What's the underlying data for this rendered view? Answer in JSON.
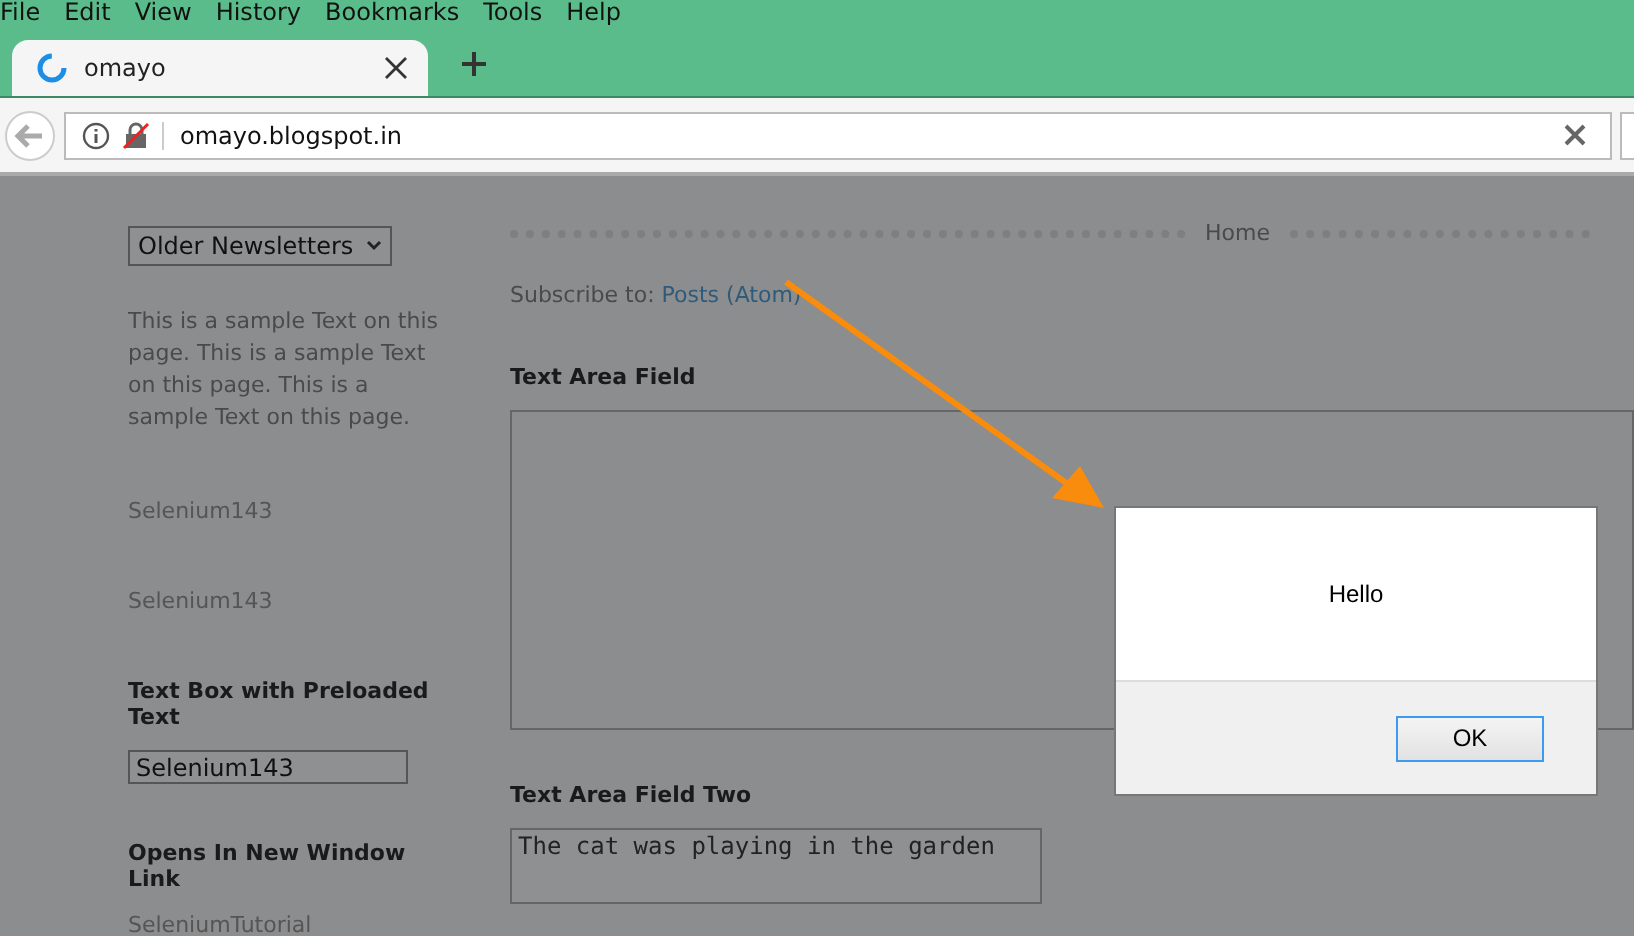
{
  "menu": [
    "File",
    "Edit",
    "View",
    "History",
    "Bookmarks",
    "Tools",
    "Help"
  ],
  "tab": {
    "title": "omayo",
    "loading": true
  },
  "address": {
    "url": "omayo.blogspot.in"
  },
  "sidebar": {
    "dropdown": "Older Newsletters",
    "paragraph": "This is a sample Text on this page. This is a sample Text on this page. This is a sample Text on this page.",
    "texts": [
      "Selenium143",
      "Selenium143"
    ],
    "textbox_heading": "Text Box with Preloaded Text",
    "textbox_value": "Selenium143",
    "link_heading": "Opens In New Window Link",
    "link": "SeleniumTutorial"
  },
  "main": {
    "nav": "Home",
    "subscribe_label": "Subscribe to:",
    "subscribe_link": "Posts (Atom)",
    "textarea_heading": "Text Area Field",
    "textarea2_heading": "Text Area Field Two",
    "textarea2_value": "The cat was playing in the garden"
  },
  "dialog": {
    "message": "Hello",
    "button": "OK"
  }
}
